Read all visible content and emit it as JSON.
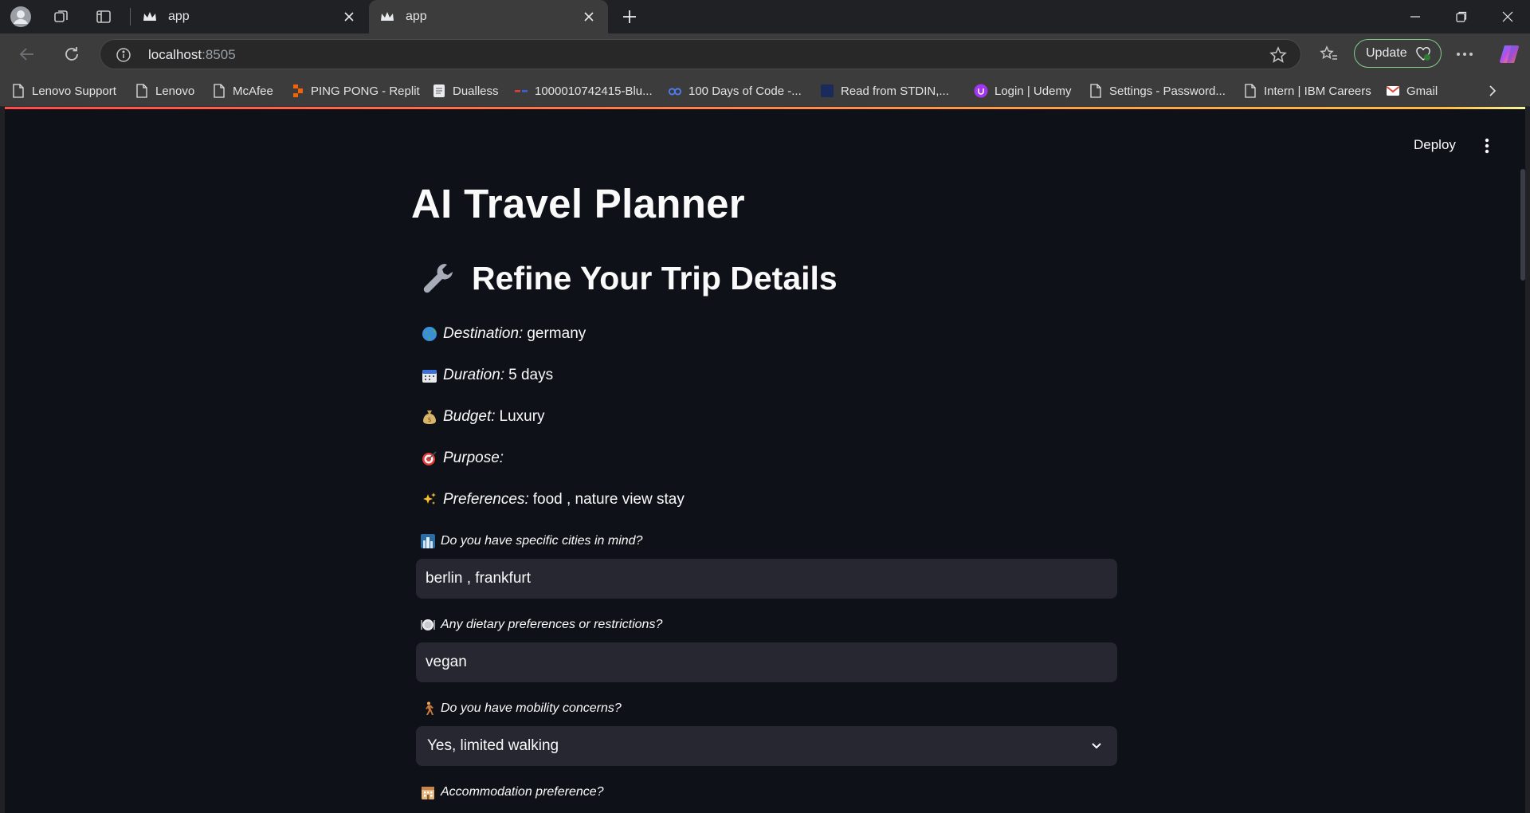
{
  "browser": {
    "tabs": [
      {
        "label": "app",
        "active": false
      },
      {
        "label": "app",
        "active": true
      }
    ],
    "address": {
      "host": "localhost",
      "port": ":8505"
    },
    "update_label": "Update",
    "bookmarks": [
      {
        "label": "Lenovo Support",
        "icon": "page-icon"
      },
      {
        "label": "Lenovo",
        "icon": "page-icon"
      },
      {
        "label": "McAfee",
        "icon": "page-icon"
      },
      {
        "label": "PING PONG - Replit",
        "icon": "replit-icon"
      },
      {
        "label": "Dualless",
        "icon": "doc-icon"
      },
      {
        "label": "1000010742415-Blu...",
        "icon": "dash-icon"
      },
      {
        "label": "100 Days of Code -...",
        "icon": "people-icon"
      },
      {
        "label": "Read from STDIN,...",
        "icon": "square-icon"
      },
      {
        "label": "Login | Udemy",
        "icon": "udemy-icon"
      },
      {
        "label": "Settings - Password...",
        "icon": "page-icon"
      },
      {
        "label": "Intern | IBM Careers",
        "icon": "page-icon"
      },
      {
        "label": "Gmail",
        "icon": "gmail-icon"
      }
    ]
  },
  "app": {
    "deploy_label": "Deploy",
    "title": "AI Travel Planner",
    "subheader": "Refine Your Trip Details",
    "details": [
      {
        "key": "Destination:",
        "value": "germany",
        "icon": "globe-icon"
      },
      {
        "key": "Duration:",
        "value": "5 days",
        "icon": "calendar-icon"
      },
      {
        "key": "Budget:",
        "value": "Luxury",
        "icon": "money-bag-icon"
      },
      {
        "key": "Purpose:",
        "value": "",
        "icon": "target-icon"
      },
      {
        "key": "Preferences:",
        "value": "food , nature view stay",
        "icon": "sparkles-icon"
      }
    ],
    "fields": {
      "cities": {
        "label": "Do you have specific cities in mind?",
        "value": "berlin , frankfurt",
        "icon": "cityscape-icon"
      },
      "dietary": {
        "label": "Any dietary preferences or restrictions?",
        "value": "vegan",
        "icon": "plate-icon"
      },
      "mobility": {
        "label": "Do you have mobility concerns?",
        "value": "Yes, limited walking",
        "icon": "walking-person-icon"
      },
      "accommodation": {
        "label": "Accommodation preference?",
        "icon": "hotel-icon"
      }
    }
  },
  "colors": {
    "page_bg": "#0e1117",
    "input_bg": "#262730",
    "text": "#fafafa",
    "browser_chrome": "#3c3c3c",
    "update_border": "#7fcf8b"
  }
}
